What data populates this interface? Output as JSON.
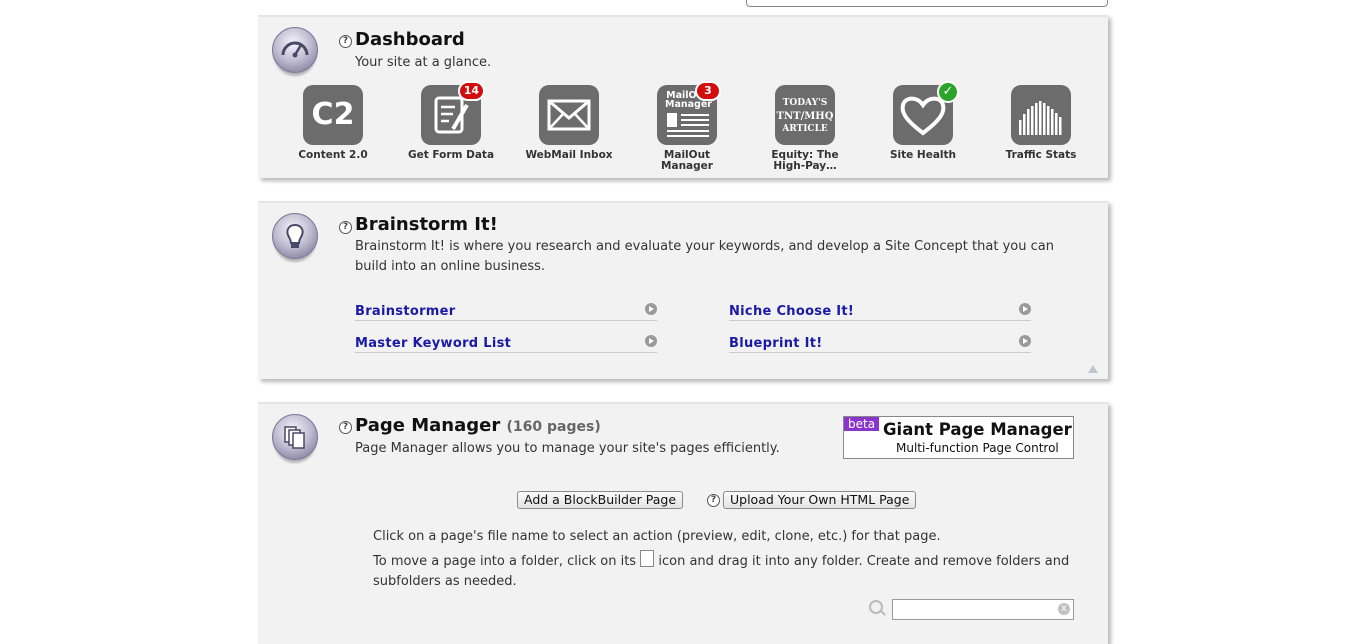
{
  "dashboard": {
    "title": "Dashboard",
    "help": "?",
    "subtitle": "Your site at a glance.",
    "apps": [
      {
        "tile": "C2",
        "label": "Content 2.0",
        "icon": "c2-icon"
      },
      {
        "label": "Get Form Data",
        "badge": "14",
        "icon": "form-icon"
      },
      {
        "label": "WebMail Inbox",
        "icon": "envelope-icon"
      },
      {
        "tile": "MailOut Manager",
        "label": "MailOut Manager",
        "badge": "3",
        "icon": "newsletter-icon"
      },
      {
        "tile_lines": [
          "TODAY'S",
          "TNT/MHQ",
          "ARTICLE"
        ],
        "label": "Equity: The High-Pay…",
        "icon": "article-icon"
      },
      {
        "label": "Site Health",
        "check": "✓",
        "icon": "heart-icon"
      },
      {
        "label": "Traffic Stats",
        "icon": "bars-icon"
      }
    ]
  },
  "brainstorm": {
    "title": "Brainstorm It!",
    "help": "?",
    "description": "Brainstorm It! is where you research and evaluate your keywords, and develop a Site Concept that you can build into an online business.",
    "links": [
      "Brainstormer",
      "Niche Choose It!",
      "Master Keyword List",
      "Blueprint It!"
    ]
  },
  "page_manager": {
    "title": "Page Manager",
    "count": "(160 pages)",
    "help": "?",
    "subtitle": "Page Manager allows you to manage your site's pages efficiently.",
    "giant": {
      "beta": "beta",
      "title": "Giant Page Manager",
      "subtitle": "Multi-function Page Control"
    },
    "add_button": "Add a BlockBuilder Page",
    "upload_button": "Upload Your Own HTML Page",
    "instructions_1": "Click on a page's file name to select an action (preview, edit, clone, etc.) for that page.",
    "instructions_2a": "To move a page into a folder, click on its",
    "instructions_2b": "icon and drag it into any folder. Create and remove folders and subfolders as needed.",
    "search_value": "",
    "clear": "x"
  },
  "colors": {
    "panel": "#f2f2f2",
    "tile": "#6c6c6c",
    "badge": "#d10d0d",
    "check": "#2aa52a",
    "link": "#1a1aa6",
    "beta": "#8b34cc"
  }
}
